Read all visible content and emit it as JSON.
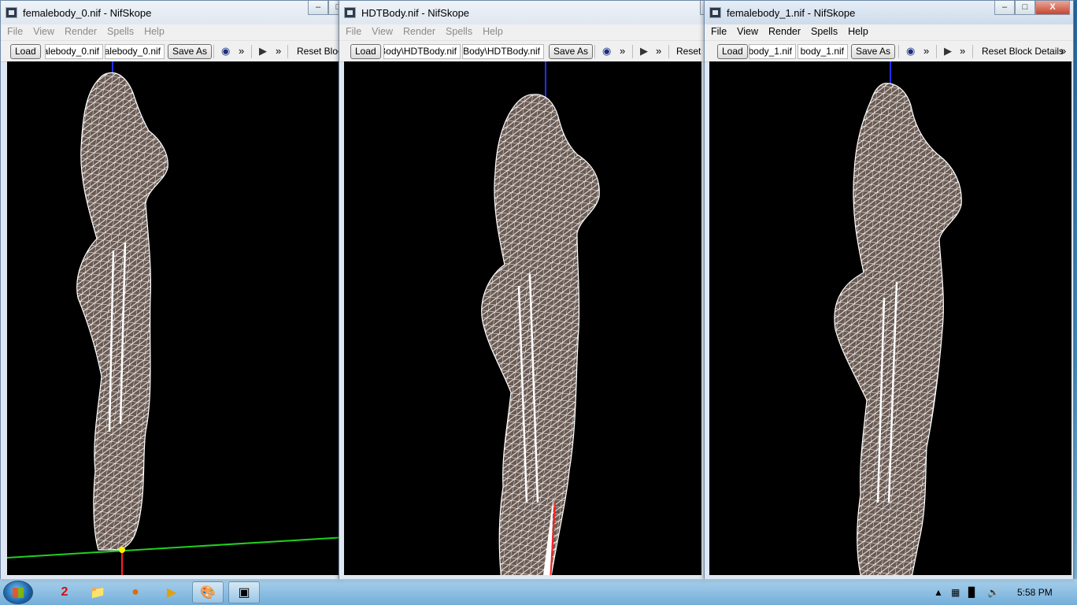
{
  "windows": [
    {
      "title": "femalebody_0.nif - NifSkope",
      "menu": [
        "File",
        "View",
        "Render",
        "Spells",
        "Help"
      ],
      "load_label": "Load",
      "file_field_1": "alebody_0.nif",
      "file_field_2": "alebody_0.nif",
      "save_label": "Save As",
      "reset_label": "Reset Block"
    },
    {
      "title": "HDTBody.nif - NifSkope",
      "menu": [
        "File",
        "View",
        "Render",
        "Spells",
        "Help"
      ],
      "load_label": "Load",
      "file_field_1": "ΓBody\\HDTBody.nif",
      "file_field_2": "TBody\\HDTBody.nif",
      "save_label": "Save As",
      "reset_label": "Reset"
    },
    {
      "title": "femalebody_1.nif - NifSkope",
      "menu": [
        "File",
        "View",
        "Render",
        "Spells",
        "Help"
      ],
      "load_label": "Load",
      "file_field_1": "body_1.nif",
      "file_field_2": "body_1.nif",
      "save_label": "Save As",
      "reset_label": "Reset Block Details"
    }
  ],
  "window_buttons": {
    "minimize": "–",
    "maximize": "□",
    "close": "X"
  },
  "toolbar_icons": {
    "view": "eye-icon",
    "play": "▶",
    "more": "»"
  },
  "taskbar": {
    "badge_number": "2",
    "clock": "5:58 PM",
    "apps": [
      "explorer-icon",
      "firefox-icon",
      "media-player-icon",
      "paint-icon",
      "nifskope-icon"
    ]
  },
  "colors": {
    "mesh_fill": "#6a5a52",
    "mesh_wire": "#ffffff",
    "axis_x": "#ff2020",
    "axis_y": "#20d020",
    "axis_z": "#2030ff",
    "viewport_bg": "#000000"
  }
}
